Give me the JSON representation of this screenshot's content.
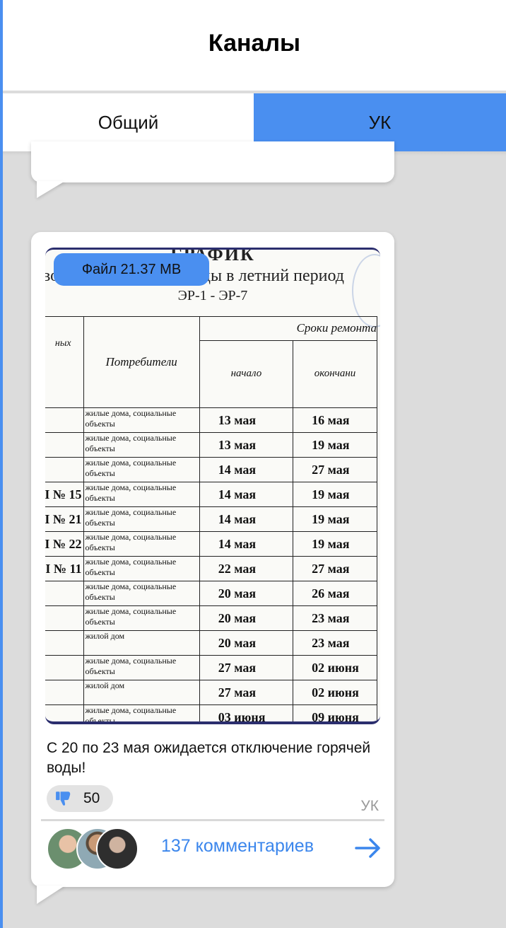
{
  "header": {
    "title": "Каналы"
  },
  "tabs": [
    {
      "label": "Общий",
      "active": false
    },
    {
      "label": "УК",
      "active": true
    }
  ],
  "post": {
    "document": {
      "title": "ГРАФИК",
      "subtitle": "вов подачи горячей воды в летний период",
      "districts": "ЭР-1 - ЭР-7",
      "headers": {
        "left": "ных",
        "consumers": "Потребители",
        "period": "Сроки ремонта",
        "start": "начало",
        "end": "окончани"
      },
      "rows": [
        {
          "num": "",
          "consumers": "жилые дома, социальные объекты",
          "start": "13 мая",
          "end": "16 мая"
        },
        {
          "num": "",
          "consumers": "жилые дома, социальные объекты",
          "start": "13 мая",
          "end": "19 мая"
        },
        {
          "num": "",
          "consumers": "жилые дома, социальные объекты",
          "start": "14 мая",
          "end": "27 мая"
        },
        {
          "num": "I № 15",
          "consumers": "жилые дома, социальные объекты",
          "start": "14 мая",
          "end": "19 мая"
        },
        {
          "num": "I № 21",
          "consumers": "жилые дома, социальные объекты",
          "start": "14 мая",
          "end": "19 мая"
        },
        {
          "num": "I № 22",
          "consumers": "жилые дома, социальные объекты",
          "start": "14 мая",
          "end": "19 мая"
        },
        {
          "num": "I № 11",
          "consumers": "жилые дома, социальные объекты",
          "start": "22 мая",
          "end": "27 мая"
        },
        {
          "num": "",
          "consumers": "жилые дома, социальные объекты",
          "start": "20 мая",
          "end": "26 мая"
        },
        {
          "num": "",
          "consumers": "жилые дома, социальные объекты",
          "start": "20 мая",
          "end": "23 мая"
        },
        {
          "num": "",
          "consumers": "жилой дом",
          "start": "20 мая",
          "end": "23 мая"
        },
        {
          "num": "",
          "consumers": "жилые дома, социальные объекты",
          "start": "27 мая",
          "end": "02 июня"
        },
        {
          "num": "",
          "consumers": "жилой дом",
          "start": "27 мая",
          "end": "02 июня"
        },
        {
          "num": "",
          "consumers": "жилые дома, социальные объекты",
          "start": "03 июня",
          "end": "09 июня"
        }
      ]
    },
    "file_label": "Файл 21.37 MB",
    "message": "С 20 по 23 мая ожидается отключение горячей воды!",
    "reaction": {
      "icon": "thumbs-down-icon",
      "count": "50"
    },
    "author": "УК",
    "comments_label": "137 комментариев"
  },
  "colors": {
    "accent": "#4a8ff0",
    "link": "#3b86ec",
    "background": "#dcdcdc"
  }
}
